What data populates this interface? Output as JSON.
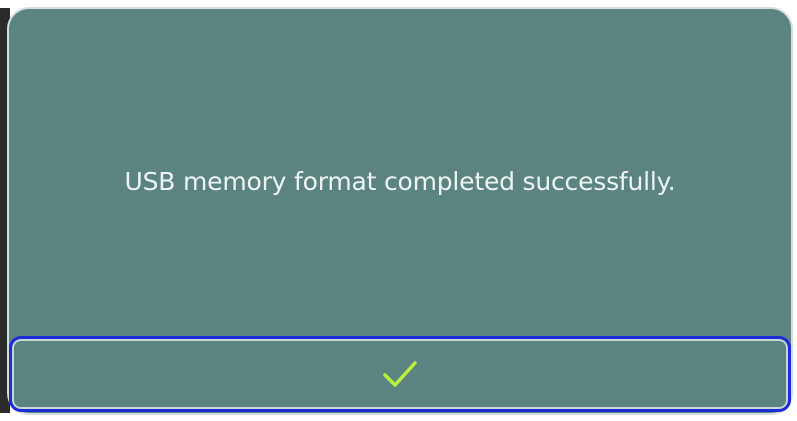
{
  "dialog": {
    "message": "USB memory format completed successfully.",
    "ok_button": {
      "icon": "check-icon"
    }
  },
  "colors": {
    "dialog_background": "#5b8480",
    "dialog_border": "#d4dedd",
    "message_text": "#eef4f3",
    "focus_border": "#1e2bd8",
    "check_accent": "#b8f03c"
  }
}
